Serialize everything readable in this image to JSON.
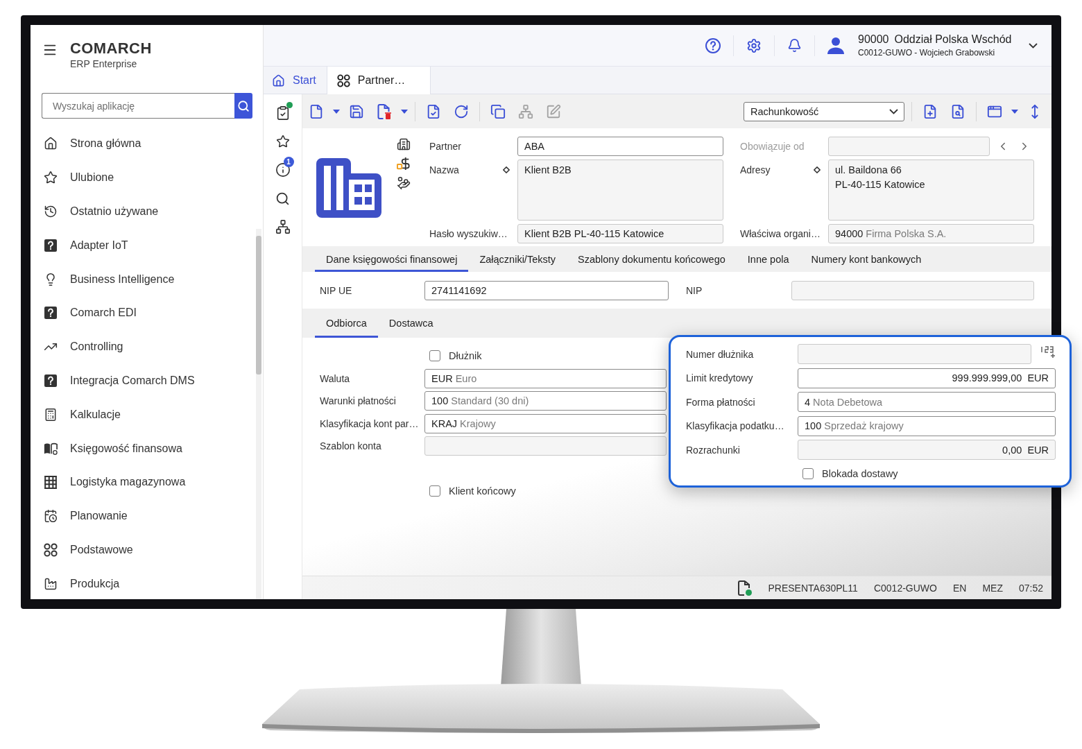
{
  "sidebar": {
    "brand": "COMARCH",
    "product": "ERP Enterprise",
    "search": {
      "placeholder": "Wyszukaj aplikację"
    },
    "items": [
      {
        "label": "Strona główna",
        "selected": false
      },
      {
        "label": "Ulubione",
        "selected": false
      },
      {
        "label": "Ostatnio używane",
        "selected": false
      },
      {
        "label": "Adapter IoT",
        "selected": false
      },
      {
        "label": "Business Intelligence",
        "selected": false
      },
      {
        "label": "Comarch EDI",
        "selected": false
      },
      {
        "label": "Controlling",
        "selected": false
      },
      {
        "label": "Integracja Comarch DMS",
        "selected": false
      },
      {
        "label": "Kalkulacje",
        "selected": false
      },
      {
        "label": "Księgowość finansowa",
        "selected": false
      },
      {
        "label": "Logistyka magazynowa",
        "selected": false
      },
      {
        "label": "Planowanie",
        "selected": false
      },
      {
        "label": "Podstawowe",
        "selected": false
      },
      {
        "label": "Produkcja",
        "selected": false
      }
    ]
  },
  "header": {
    "organization_code": "90000",
    "organization_name": "Oddział Polska Wschód",
    "account": "C0012-GUWO - Wojciech Grabowski"
  },
  "tabs": [
    {
      "label": "Start",
      "selected": false
    },
    {
      "label": "Partner…",
      "selected": true
    }
  ],
  "rail": {
    "info_badge": "1"
  },
  "toolbar": {
    "left": [
      {
        "disabled": false
      },
      {
        "disabled": false
      },
      {
        "disabled": false
      },
      {
        "disabled": false
      },
      {
        "disabled": false
      },
      {
        "disabled": false
      },
      {
        "disabled": false
      },
      {
        "disabled": false
      },
      {
        "disabled": true
      },
      {
        "disabled": true
      }
    ],
    "view": {
      "value": "Rachunkowość"
    },
    "right": [
      {
        "disabled": false
      },
      {
        "disabled": false
      },
      {
        "disabled": false
      },
      {
        "disabled": false
      },
      {
        "disabled": false
      }
    ]
  },
  "partner_header": {
    "left": [
      {
        "kind": "text",
        "label": "Partner",
        "value": "ABA",
        "readonly": false,
        "disabled": false,
        "marked": false
      },
      {
        "kind": "multiline",
        "label": "Nazwa",
        "lines": [
          "Klient B2B"
        ],
        "readonly": true,
        "disabled": false,
        "marked": true
      },
      {
        "kind": "text",
        "label": "Hasło wyszukiw…",
        "value": "Klient B2B PL-40-115 Katowice",
        "readonly": true,
        "disabled": false,
        "marked": false
      }
    ],
    "right": [
      {
        "kind": "text",
        "label": "Obowiązuje od",
        "readonly": true,
        "disabled": true,
        "marked": false
      },
      {
        "kind": "multiline",
        "label": "Adresy",
        "lines": [
          "ul. Baildona 66",
          "PL-40-115 Katowice"
        ],
        "readonly": true,
        "disabled": false,
        "marked": true
      },
      {
        "kind": "coded",
        "label": "Właściwa organi…",
        "code": "94000",
        "description": "Firma Polska S.A.",
        "readonly": true,
        "disabled": false,
        "marked": false
      }
    ]
  },
  "section_tabs": [
    {
      "label": "Dane księgowości finansowej",
      "selected": true
    },
    {
      "label": "Załączniki/Teksty",
      "selected": false
    },
    {
      "label": "Szablony dokumentu końcowego",
      "selected": false
    },
    {
      "label": "Inne pola",
      "selected": false
    },
    {
      "label": "Numery kont bankowych",
      "selected": false
    }
  ],
  "tax_ids": [
    {
      "kind": "text",
      "label": "NIP UE",
      "value": "2741141692",
      "readonly": false
    },
    {
      "kind": "text",
      "label": "NIP",
      "readonly": true
    }
  ],
  "sub_tabs": [
    {
      "label": "Odbiorca",
      "selected": true
    },
    {
      "label": "Dostawca",
      "selected": false
    }
  ],
  "customer_form": {
    "debtor": {
      "label": "Dłużnik",
      "checked": false
    },
    "fields": [
      {
        "kind": "coded",
        "label": "Waluta",
        "code": "EUR",
        "description": "Euro",
        "readonly": false
      },
      {
        "kind": "coded",
        "label": "Warunki płatności",
        "code": "100",
        "description": "Standard (30 dni)",
        "readonly": false
      },
      {
        "kind": "coded",
        "label": "Klasyfikacja kont par…",
        "code": "KRAJ",
        "description": "Krajowy",
        "readonly": false
      },
      {
        "kind": "text",
        "label": "Szablon konta",
        "readonly": true
      }
    ],
    "end_customer": {
      "label": "Klient końcowy",
      "checked": false
    }
  },
  "callout": {
    "fields": [
      {
        "kind": "text",
        "label": "Numer dłużnika",
        "readonly": true
      },
      {
        "kind": "amount",
        "label": "Limit kredytowy",
        "amount": "999.999.999,00",
        "currency": "EUR",
        "readonly": false
      },
      {
        "kind": "coded",
        "label": "Forma płatności",
        "code": "4",
        "description": "Nota Debetowa",
        "readonly": false
      },
      {
        "kind": "coded",
        "label": "Klasyfikacja podatku…",
        "code": "100",
        "description": "Sprzedaż krajowy",
        "readonly": false
      },
      {
        "kind": "amount",
        "label": "Rozrachunki",
        "amount": "0,00",
        "currency": "EUR",
        "readonly": true
      }
    ],
    "delivery_block": {
      "label": "Blokada dostawy",
      "checked": false
    }
  },
  "status_bar": {
    "items": [
      "PRESENTA630PL11",
      "C0012-GUWO",
      "EN",
      "MEZ",
      "07:52"
    ]
  }
}
